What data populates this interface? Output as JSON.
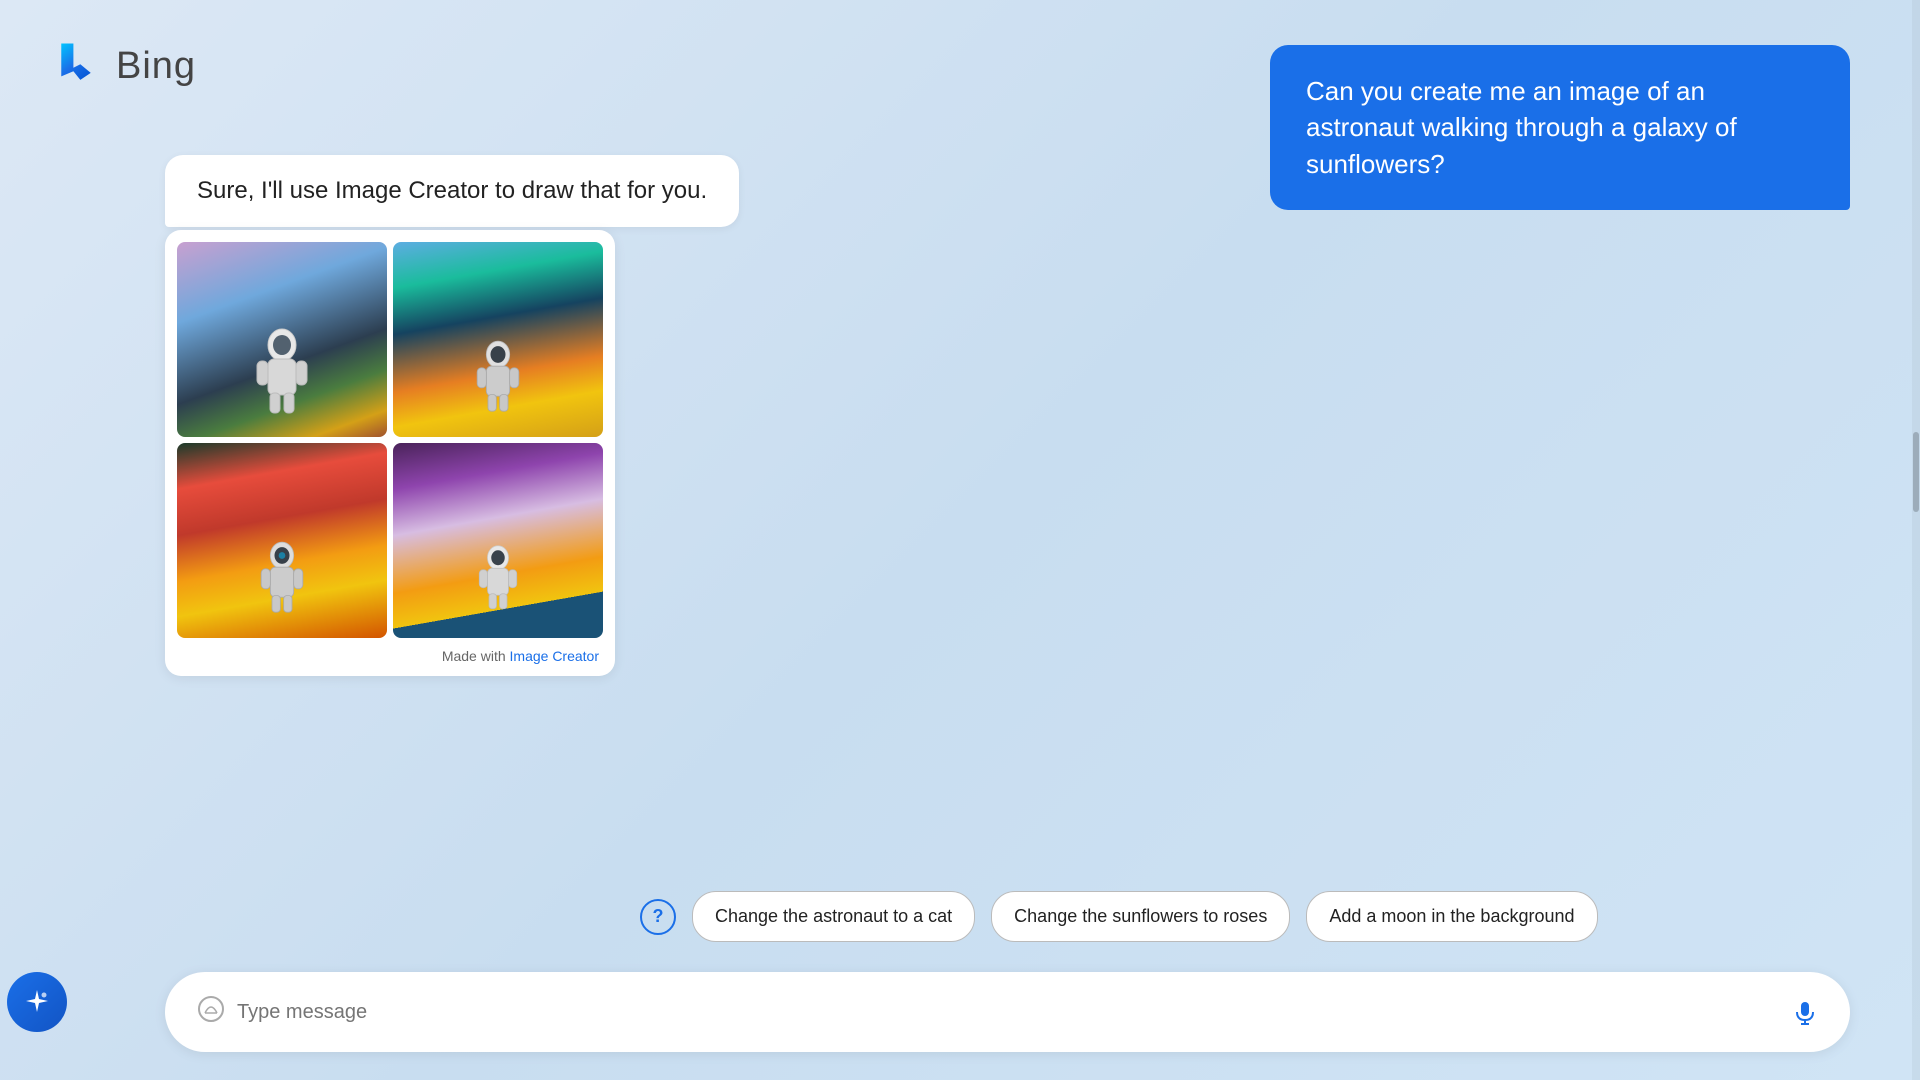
{
  "app": {
    "title": "Bing"
  },
  "header": {
    "logo_alt": "Bing logo",
    "title": "Bing"
  },
  "user_message": {
    "text": "Can you create me an image of an astronaut walking through a galaxy of sunflowers?"
  },
  "assistant_message": {
    "text": "Sure, I'll use Image Creator to draw that for you."
  },
  "image_card": {
    "footer_prefix": "Made with ",
    "footer_link": "Image Creator"
  },
  "suggestions": {
    "help_label": "?",
    "chips": [
      {
        "id": "chip-1",
        "label": "Change the astronaut to a cat"
      },
      {
        "id": "chip-2",
        "label": "Change the sunflowers to roses"
      },
      {
        "id": "chip-3",
        "label": "Add a moon in the background"
      }
    ]
  },
  "chat_input": {
    "placeholder": "Type message"
  }
}
